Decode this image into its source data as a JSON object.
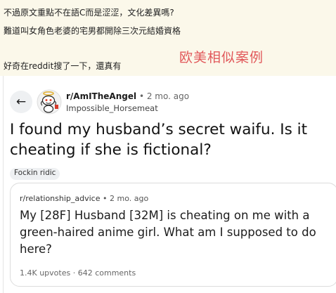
{
  "forum": {
    "line1": "不過原文重點不在語C而是涩涩，文化差異嗎?",
    "line2": "難道叫女角色老婆的宅男都開除三次元結婚資格",
    "line3": "好奇在reddit搜了一下，還真有",
    "watermark": "欧美相似案例"
  },
  "post": {
    "subreddit": "r/AmITheAngel",
    "separator": "•",
    "time_ago": "2 mo. ago",
    "username": "Impossible_Horsemeat",
    "title": "I found my husband’s secret waifu. Is it cheating if she is fictional?",
    "flair": "Fockin ridic",
    "back_icon": "arrow-left-icon",
    "avatar_icon": "snoo-angel-avatar-icon"
  },
  "crosspost": {
    "subreddit": "r/relationship_advice",
    "separator": "•",
    "time_ago": "2 mo. ago",
    "title": "My [28F] Husband [32M] is cheating on me with a green-haired anime girl. What am I supposed to do here?",
    "upvotes": "1.4K upvotes",
    "stat_separator": "·",
    "comments": "642 comments"
  },
  "colors": {
    "forum_background": "#fbf8ea",
    "watermark": "#e1585a",
    "card_border": "#dcdcdc",
    "button_background": "#eef0f2"
  }
}
